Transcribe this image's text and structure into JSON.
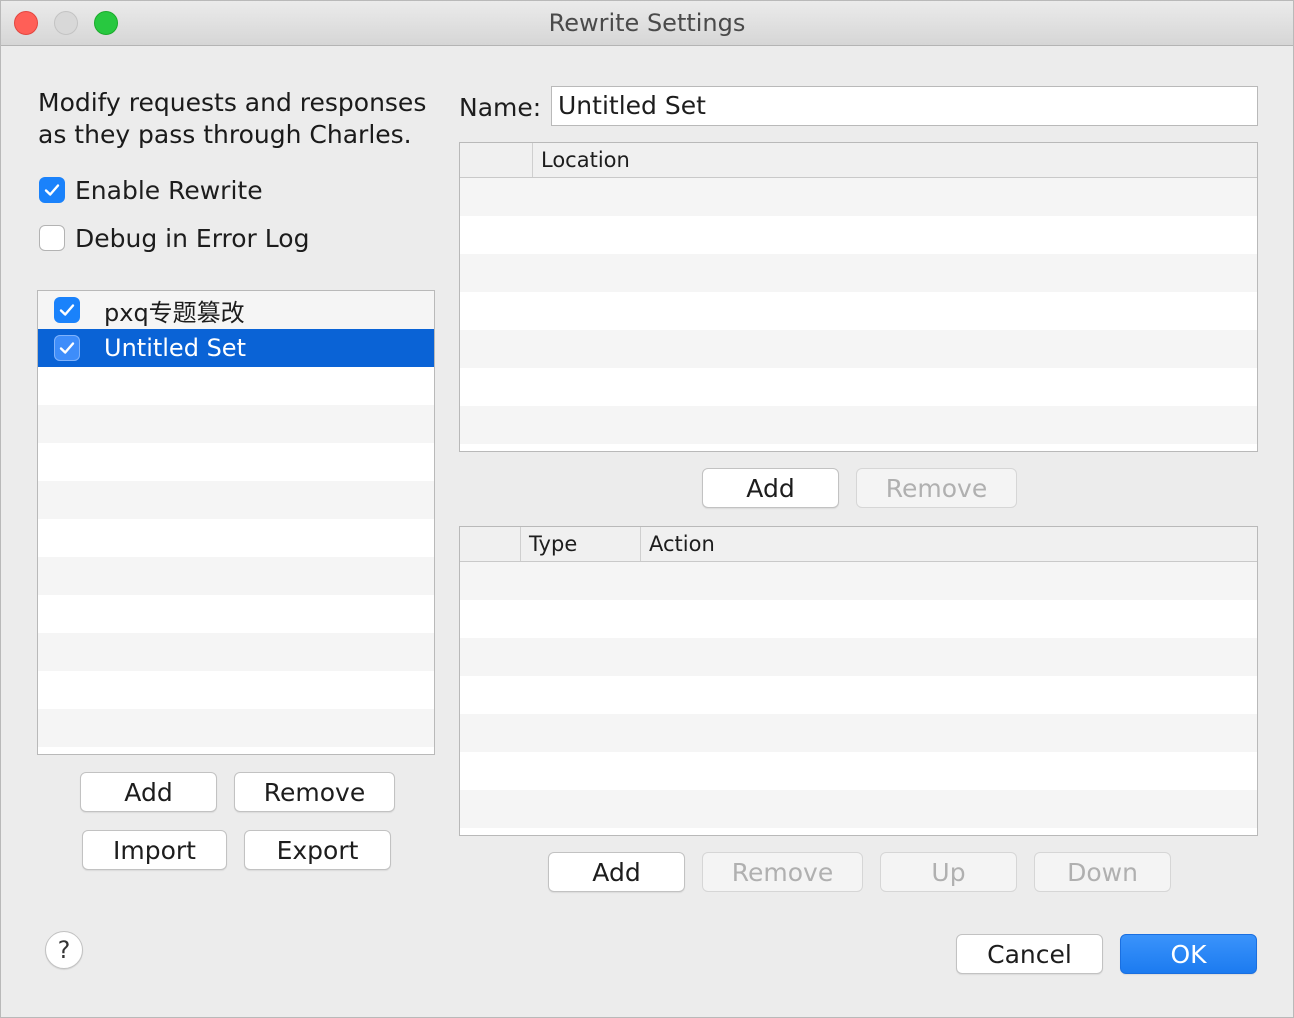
{
  "window": {
    "title": "Rewrite Settings"
  },
  "left": {
    "description": [
      "Modify requests and responses",
      "as they pass through Charles."
    ],
    "enable_rewrite": {
      "label": "Enable Rewrite",
      "checked": true
    },
    "debug_log": {
      "label": "Debug in Error Log",
      "checked": false
    },
    "sets": [
      {
        "label": "pxq专题篡改",
        "checked": true,
        "selected": false
      },
      {
        "label": "Untitled Set",
        "checked": true,
        "selected": true
      }
    ],
    "buttons": {
      "add": "Add",
      "remove": "Remove",
      "import": "Import",
      "export": "Export"
    }
  },
  "right": {
    "name_label": "Name:",
    "name_value": "Untitled Set",
    "location_table": {
      "columns": [
        "Location"
      ]
    },
    "location_buttons": {
      "add": "Add",
      "remove": "Remove"
    },
    "rules_table": {
      "columns": [
        "Type",
        "Action"
      ]
    },
    "rules_buttons": {
      "add": "Add",
      "remove": "Remove",
      "up": "Up",
      "down": "Down"
    }
  },
  "footer": {
    "help": "?",
    "cancel": "Cancel",
    "ok": "OK"
  },
  "colors": {
    "accent": "#1a82fb",
    "selection": "#0a63d6"
  }
}
